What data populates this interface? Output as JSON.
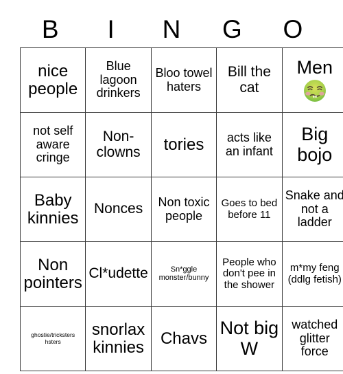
{
  "card": {
    "header_letters": [
      "B",
      "I",
      "N",
      "G",
      "O"
    ],
    "rows": [
      [
        {
          "text": "nice people",
          "size": "xl"
        },
        {
          "text": "Blue lagoon drinkers",
          "size": "md"
        },
        {
          "text": "Bloo towel haters",
          "size": "md"
        },
        {
          "text": "Bill the cat",
          "size": "lg"
        },
        {
          "text": "Men",
          "size": "xxl",
          "emoji": "nauseated-face"
        }
      ],
      [
        {
          "text": "not self aware cringe",
          "size": "md"
        },
        {
          "text": "Non-clowns",
          "size": "lg"
        },
        {
          "text": "tories",
          "size": "xl"
        },
        {
          "text": "acts like an infant",
          "size": "md"
        },
        {
          "text": "Big bojo",
          "size": "xxl"
        }
      ],
      [
        {
          "text": "Baby kinnies",
          "size": "xl"
        },
        {
          "text": "Nonces",
          "size": "lg"
        },
        {
          "text": "Non toxic people",
          "size": "md"
        },
        {
          "text": "Goes to bed before 11",
          "size": "sm"
        },
        {
          "text": "Snake and not a ladder",
          "size": "md"
        }
      ],
      [
        {
          "text": "Non pointers",
          "size": "xl"
        },
        {
          "text": "Cl*udette",
          "size": "lg"
        },
        {
          "text": "Sn*ggle monster/bunny",
          "size": "xs"
        },
        {
          "text": "People who don't pee in the shower",
          "size": "sm"
        },
        {
          "text": "m*my feng (ddlg fetish)",
          "size": "sm"
        }
      ],
      [
        {
          "text": "ghostie/tricksters hsters",
          "size": "xxs"
        },
        {
          "text": "snorlax kinnies",
          "size": "xl"
        },
        {
          "text": "Chavs",
          "size": "xl"
        },
        {
          "text": "Not big W",
          "size": "xxl"
        },
        {
          "text": "watched glitter force",
          "size": "md"
        }
      ]
    ]
  },
  "colors": {
    "grid_line": "#3b3b3b",
    "text": "#000000",
    "background": "#ffffff",
    "emoji_green_light": "#b9d44a",
    "emoji_green_dark": "#77c043",
    "emoji_cheek": "#e79caa",
    "emoji_feature": "#5a4a33"
  }
}
